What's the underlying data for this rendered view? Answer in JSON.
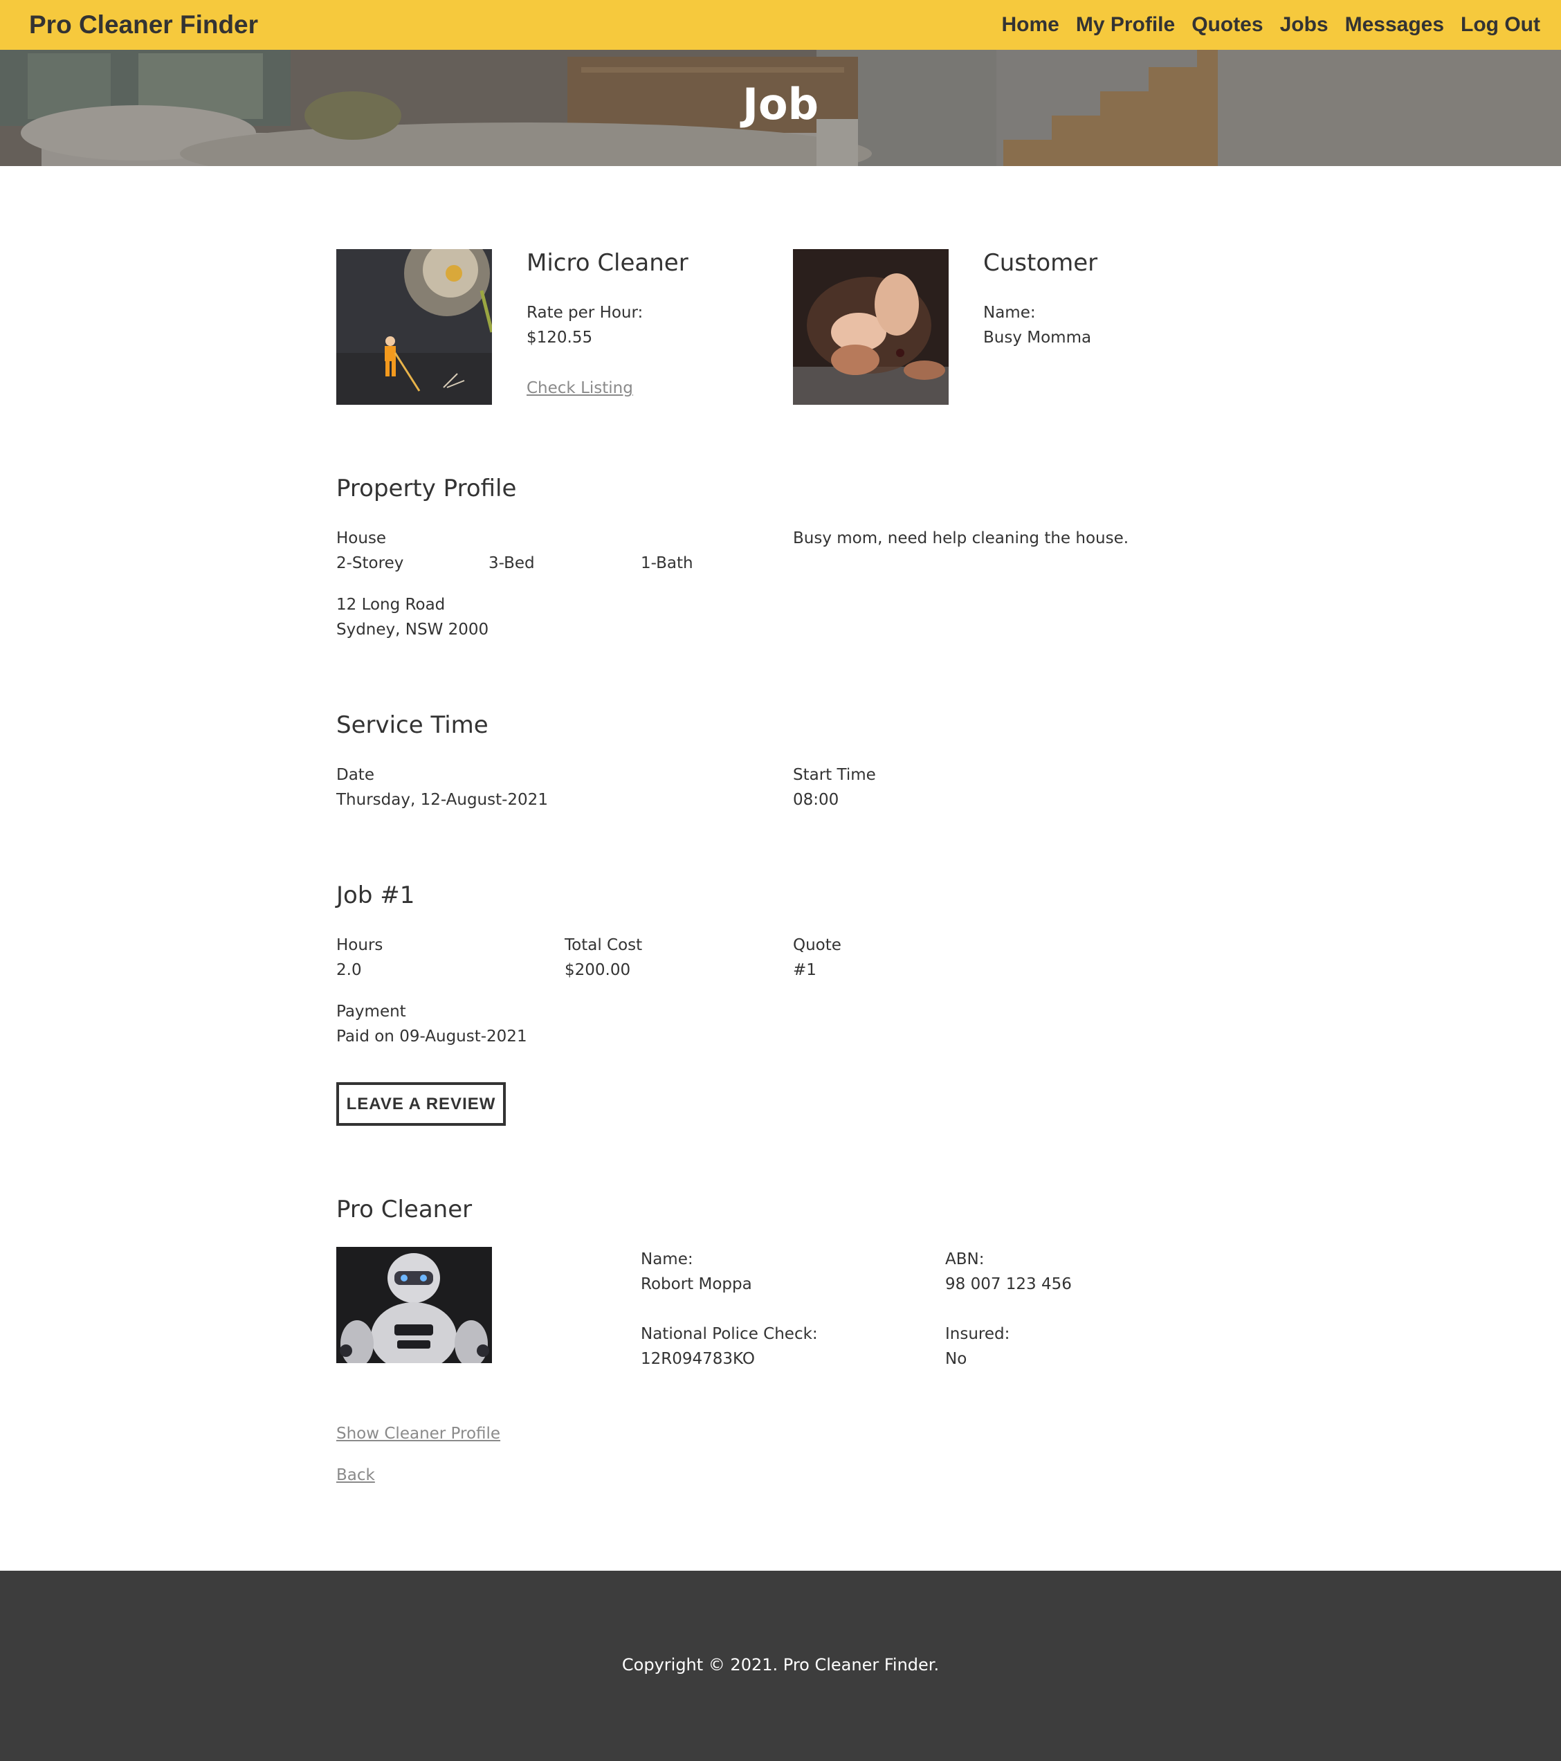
{
  "navbar": {
    "brand": "Pro Cleaner Finder",
    "links": [
      "Home",
      "My Profile",
      "Quotes",
      "Jobs",
      "Messages",
      "Log Out"
    ]
  },
  "hero": {
    "title": "Job"
  },
  "listing": {
    "title": "Micro Cleaner",
    "rate_label": "Rate per Hour:",
    "rate_value": "$120.55",
    "link": "Check Listing"
  },
  "customer": {
    "title": "Customer",
    "name_label": "Name:",
    "name_value": "Busy Momma"
  },
  "property": {
    "title": "Property Profile",
    "type": "House",
    "storey": "2-Storey",
    "beds": "3-Bed",
    "baths": "1-Bath",
    "address_line1": "12 Long Road",
    "address_line2": "Sydney, NSW 2000",
    "note": "Busy mom, need help cleaning the house."
  },
  "service": {
    "title": "Service Time",
    "date_label": "Date",
    "date_value": "Thursday, 12-August-2021",
    "start_label": "Start Time",
    "start_value": "08:00"
  },
  "job": {
    "title": "Job #1",
    "hours_label": "Hours",
    "hours_value": "2.0",
    "cost_label": "Total Cost",
    "cost_value": "$200.00",
    "quote_label": "Quote",
    "quote_value": "#1",
    "payment_label": "Payment",
    "payment_value": "Paid on 09-August-2021",
    "review_button": "LEAVE A REVIEW"
  },
  "cleaner": {
    "title": "Pro Cleaner",
    "name_label": "Name:",
    "name_value": "Robort Moppa",
    "abn_label": "ABN:",
    "abn_value": "98 007 123 456",
    "police_label": "National Police Check:",
    "police_value": "12R094783KO",
    "insured_label": "Insured:",
    "insured_value": "No"
  },
  "links": {
    "show_profile": "Show Cleaner Profile",
    "back": "Back"
  },
  "footer": {
    "copyright": "Copyright © 2021. Pro Cleaner Finder."
  },
  "colors": {
    "navbar": "#f6c93d",
    "footer": "#3d3d3d",
    "text": "#333333",
    "link": "#8a8a8a"
  }
}
